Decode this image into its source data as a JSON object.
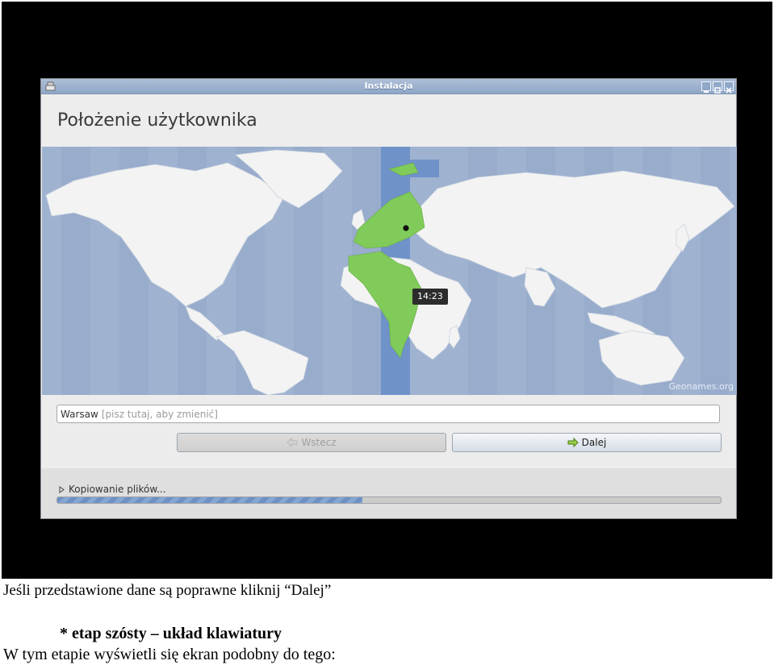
{
  "window": {
    "title": "Instalacja",
    "icon": "installer-icon"
  },
  "page": {
    "title": "Położenie użytkownika"
  },
  "map": {
    "time_label": "14:23",
    "attribution": "Geonames.org"
  },
  "location": {
    "value": "Warsaw",
    "placeholder": "[pisz tutaj, aby zmienić]"
  },
  "buttons": {
    "back_label": "Wstecz",
    "next_label": "Dalej"
  },
  "status": {
    "label": "Kopiowanie plików...",
    "progress": 0.46
  },
  "captions": {
    "line1": "Jeśli przedstawione dane są poprawne kliknij “Dalej”",
    "line2": "* etap szósty – układ klawiatury",
    "line3": "W tym etapie wyświetli się ekran podobny do tego:"
  },
  "colors": {
    "map_ocean": "#9fb2d0",
    "land": "#f3f3f3",
    "selected_timezone": "#80cb5a",
    "timezone_band": "#6f92c9"
  }
}
